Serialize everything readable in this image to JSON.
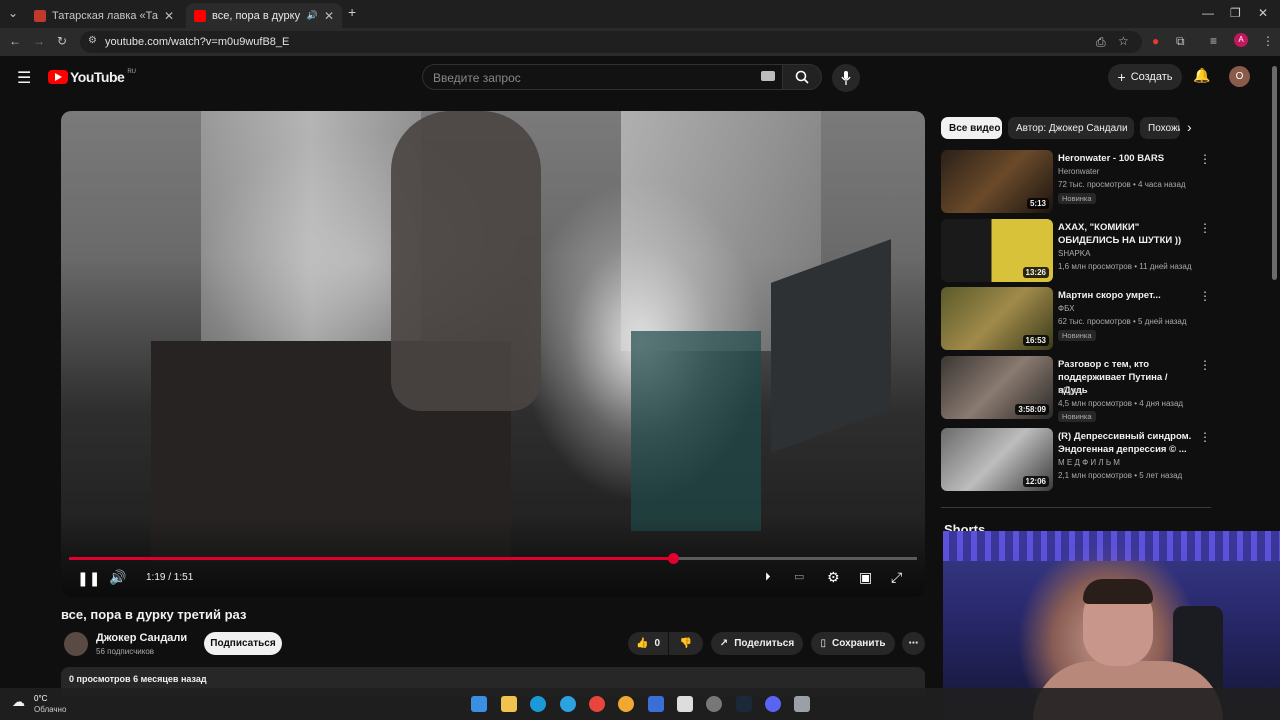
{
  "browser": {
    "tabs": [
      {
        "title": "Татарская лавка «Татарча» —",
        "favicon_color": "#c0392b",
        "active": false
      },
      {
        "title": "все, пора в дурку третий р",
        "favicon_color": "#ff0000",
        "active": true
      }
    ],
    "url": "youtube.com/watch?v=m0u9wufB8_E",
    "profile_initial": "A"
  },
  "youtube": {
    "logo_text": "YouTube",
    "region": "RU",
    "search_placeholder": "Введите запрос",
    "create_label": "Создать",
    "avatar_initial": "О"
  },
  "player": {
    "time": "1:19 / 1:51",
    "progress_fraction": 0.712
  },
  "video": {
    "title": "все, пора в дурку третий раз",
    "channel": "Джокер Сандали",
    "subscribers": "56 подписчиков",
    "subscribe_label": "Подписаться",
    "likes": "0",
    "share_label": "Поделиться",
    "save_label": "Сохранить",
    "stats": "0 просмотров  6 месяцев назад"
  },
  "chips": [
    "Все видео",
    "Автор: Джокер Сандали",
    "Похожи"
  ],
  "recommendations": [
    {
      "title": "Heronwater - 100 BARS",
      "channel": "Heronwater",
      "meta": "72 тыс. просмотров • 4 часа назад",
      "duration": "5:13",
      "badge": "Новинка",
      "thumb": "#3a2a22"
    },
    {
      "title": "АХАХ, \"КОМИКИ\" ОБИДЕЛИСЬ НА ШУТКИ ))",
      "channel": "SHAPKA",
      "meta": "1,6 млн просмотров • 11 дней назад",
      "duration": "13:26",
      "badge": "",
      "thumb": "#b5a23a"
    },
    {
      "title": "Мартин скоро умрет...",
      "channel": "ФБХ",
      "meta": "62 тыс. просмотров • 5 дней назад",
      "duration": "16:53",
      "badge": "Новинка",
      "thumb": "#7a6a3a"
    },
    {
      "title": "Разговор с тем, кто поддерживает Путина / вДудь",
      "channel": "вДудь",
      "meta": "4,5 млн просмотров • 4 дня назад",
      "duration": "3:58:09",
      "badge": "Новинка",
      "thumb": "#5a5450"
    },
    {
      "title": "(R) Депрессивный синдром. Эндогенная депрессия © ...",
      "channel": "М Е Д Ф И Л Ь М",
      "meta": "2,1 млн просмотров • 5 лет назад",
      "duration": "12:06",
      "badge": "",
      "thumb": "#4a4a4a"
    }
  ],
  "shorts_label": "Shorts",
  "taskbar": {
    "temperature": "0°C",
    "condition": "Облачно"
  }
}
